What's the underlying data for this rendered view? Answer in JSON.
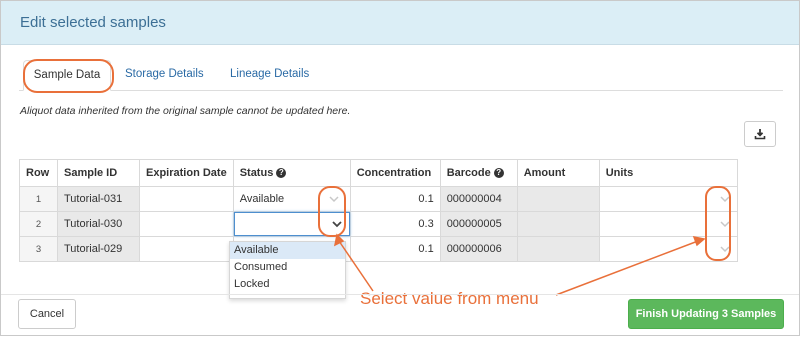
{
  "modal": {
    "title": "Edit selected samples"
  },
  "tabs": [
    {
      "label": "Sample Data",
      "active": true
    },
    {
      "label": "Storage Details",
      "active": false
    },
    {
      "label": "Lineage Details",
      "active": false
    }
  ],
  "note": "Aliquot data inherited from the original sample cannot be updated here.",
  "toolbar": {
    "export_icon": "download-icon"
  },
  "grid": {
    "columns": [
      "Row",
      "Sample ID",
      "Expiration Date",
      "Status",
      "Concentration",
      "Barcode",
      "Amount",
      "Units"
    ],
    "help_icon_columns": [
      "Status",
      "Barcode"
    ],
    "help_icon_glyph": "?",
    "rows": [
      {
        "row": "1",
        "sample_id": "Tutorial-031",
        "expiration_date": "",
        "status": "Available",
        "concentration": "0.1",
        "barcode": "000000004",
        "amount": "",
        "units": ""
      },
      {
        "row": "2",
        "sample_id": "Tutorial-030",
        "expiration_date": "",
        "status": "",
        "concentration": "0.3",
        "barcode": "000000005",
        "amount": "",
        "units": ""
      },
      {
        "row": "3",
        "sample_id": "Tutorial-029",
        "expiration_date": "",
        "status": "",
        "concentration": "0.1",
        "barcode": "000000006",
        "amount": "",
        "units": ""
      }
    ]
  },
  "status_menu": {
    "options": [
      "Available",
      "Consumed",
      "Locked"
    ],
    "highlighted": "Available"
  },
  "annotation": {
    "text": "Select value from menu",
    "color": "#e9703a"
  },
  "footer": {
    "cancel_label": "Cancel",
    "finish_label": "Finish Updating 3 Samples"
  },
  "colors": {
    "header_bg": "#dbeef6",
    "title": "#3c6f95",
    "link": "#2a6aa5",
    "readonly_cell": "#e9e9e9",
    "primary_button": "#5cb85c",
    "annotation": "#e9703a"
  }
}
